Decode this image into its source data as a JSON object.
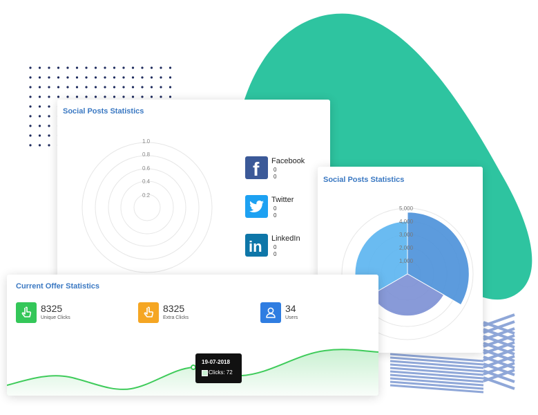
{
  "decor": {
    "blob_color": "#2ec4a0",
    "stripe_color": "#8fa7d8",
    "dot_color": "#1d2a5c"
  },
  "social_card": {
    "title": "Social Posts Statistics",
    "radar_ticks": [
      "1.0",
      "0.8",
      "0.6",
      "0.4",
      "0.2"
    ],
    "items": [
      {
        "icon": "facebook-icon",
        "name": "Facebook",
        "values": [
          "0",
          "0"
        ],
        "color": "#3b5998"
      },
      {
        "icon": "twitter-icon",
        "name": "Twitter",
        "values": [
          "0",
          "0"
        ],
        "color": "#1da1f2"
      },
      {
        "icon": "linkedin-icon",
        "name": "LinkedIn",
        "values": [
          "0",
          "0"
        ],
        "color": "#0e76a8"
      }
    ]
  },
  "polar_card": {
    "title": "Social Posts Statistics",
    "ticks": [
      "5,000",
      "4,000",
      "3,000",
      "2,000",
      "1,000"
    ]
  },
  "offer_card": {
    "title": "Current Offer Statistics",
    "stats": [
      {
        "icon": "hand-pointer-icon",
        "value": "8325",
        "label": "Unique Clicks",
        "color": "#34c759"
      },
      {
        "icon": "hand-pointer-icon",
        "value": "8325",
        "label": "Extra Clicks",
        "color": "#f5a623"
      },
      {
        "icon": "user-icon",
        "value": "34",
        "label": "Users",
        "color": "#2f7de1"
      }
    ],
    "tooltip": {
      "date": "19-07-2018",
      "label": "Clicks: 72"
    },
    "line_color": "#3ecb5a"
  },
  "chart_data": [
    {
      "type": "radar",
      "title": "Social Posts Statistics",
      "rlim": [
        0,
        1.0
      ],
      "ticks": [
        0.2,
        0.4,
        0.6,
        0.8,
        1.0
      ],
      "series": [],
      "grid": true
    },
    {
      "type": "pie",
      "title": "Social Posts Statistics",
      "rlim": [
        0,
        5000
      ],
      "ticks": [
        1000,
        2000,
        3000,
        4000,
        5000
      ],
      "values": [
        4700,
        3200,
        4000
      ],
      "colors": [
        "#4a90d9",
        "#7b8fd4",
        "#5ab4f0"
      ],
      "grid": true
    },
    {
      "type": "area",
      "title": "Current Offer Statistics",
      "annotations": [
        {
          "date": "19-07-2018",
          "clicks": 72
        }
      ]
    }
  ]
}
